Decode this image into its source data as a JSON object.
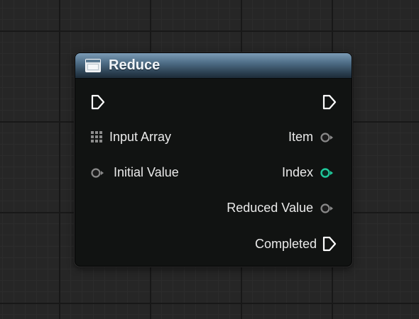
{
  "node": {
    "title": "Reduce",
    "inputs": {
      "array_label": "Input Array",
      "initial_value_label": "Initial Value"
    },
    "outputs": {
      "item_label": "Item",
      "index_label": "Index",
      "reduced_value_label": "Reduced Value",
      "completed_label": "Completed"
    }
  },
  "colors": {
    "header": "#4d6c85",
    "index_pin": "#1fc99b",
    "default_pin": "#7a7a7a",
    "exec_pin": "#ffffff"
  },
  "icons": {
    "header": "function-icon",
    "exec": "exec-pin-icon",
    "array": "array-grid-icon",
    "data_pin": "data-pin-icon"
  }
}
